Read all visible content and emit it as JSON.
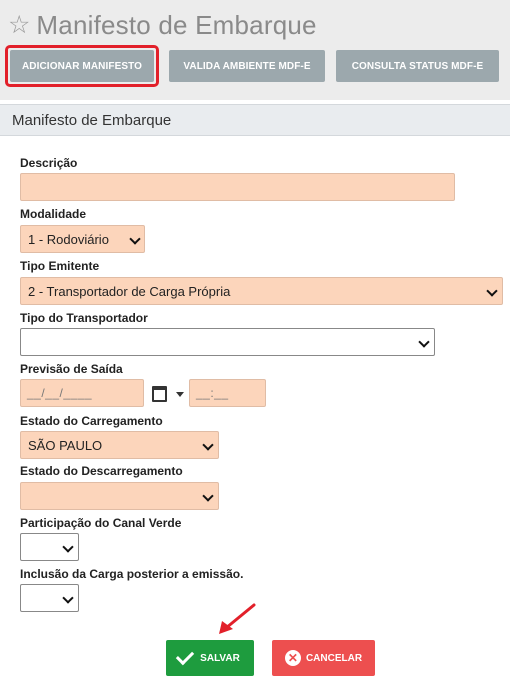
{
  "page": {
    "title": "Manifesto de Embarque"
  },
  "toolbar": {
    "add_manifest": "ADICIONAR MANIFESTO",
    "validate_env": "VALIDA AMBIENTE MDF-E",
    "consult_status": "CONSULTA STATUS MDF-E"
  },
  "section": {
    "title": "Manifesto de Embarque"
  },
  "form": {
    "descricao": {
      "label": "Descrição",
      "value": ""
    },
    "modalidade": {
      "label": "Modalidade",
      "value": "1 - Rodoviário"
    },
    "tipo_emitente": {
      "label": "Tipo Emitente",
      "value": "2 - Transportador de Carga Própria"
    },
    "tipo_transportador": {
      "label": "Tipo do Transportador",
      "value": ""
    },
    "previsao_saida": {
      "label": "Previsão de Saída",
      "date_mask": "__/__/____",
      "time_mask": "__:__"
    },
    "estado_carregamento": {
      "label": "Estado do Carregamento",
      "value": "SÃO PAULO"
    },
    "estado_descarregamento": {
      "label": "Estado do Descarregamento",
      "value": ""
    },
    "canal_verde": {
      "label": "Participação do Canal Verde",
      "value": ""
    },
    "carga_posterior": {
      "label": "Inclusão da Carga posterior a emissão.",
      "value": ""
    }
  },
  "actions": {
    "save": "SALVAR",
    "cancel": "CANCELAR"
  },
  "colors": {
    "required_field": "#fcd5bb",
    "save": "#1e9c3e",
    "cancel": "#ed4f4f",
    "highlight": "#e2202a",
    "toolbar_button": "#9ca8ad"
  }
}
